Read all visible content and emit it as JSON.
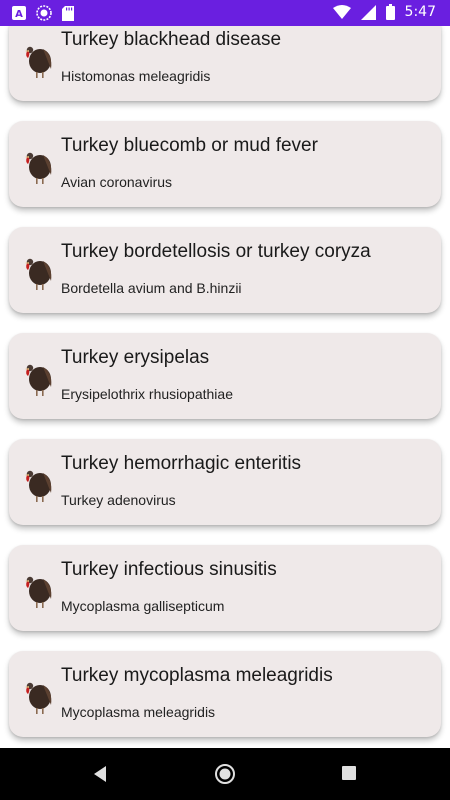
{
  "status_bar": {
    "time": "5:47",
    "icons": [
      "notification-a-icon",
      "circle-icon",
      "sd-card-icon",
      "wifi-icon",
      "signal-icon",
      "battery-icon"
    ]
  },
  "diseases": [
    {
      "title": "Turkey blackhead disease",
      "subtitle": "Histomonas meleagridis"
    },
    {
      "title": "Turkey bluecomb or mud fever",
      "subtitle": "Avian coronavirus"
    },
    {
      "title": "Turkey bordetellosis or turkey coryza",
      "subtitle": "Bordetella avium and B.hinzii"
    },
    {
      "title": "Turkey erysipelas",
      "subtitle": "Erysipelothrix rhusiopathiae"
    },
    {
      "title": "Turkey hemorrhagic enteritis",
      "subtitle": "Turkey adenovirus"
    },
    {
      "title": "Turkey infectious sinusitis",
      "subtitle": "Mycoplasma gallisepticum"
    },
    {
      "title": "Turkey mycoplasma meleagridis",
      "subtitle": "Mycoplasma meleagridis"
    }
  ],
  "nav": {
    "icons": [
      "back-icon",
      "home-icon",
      "recents-icon"
    ]
  }
}
